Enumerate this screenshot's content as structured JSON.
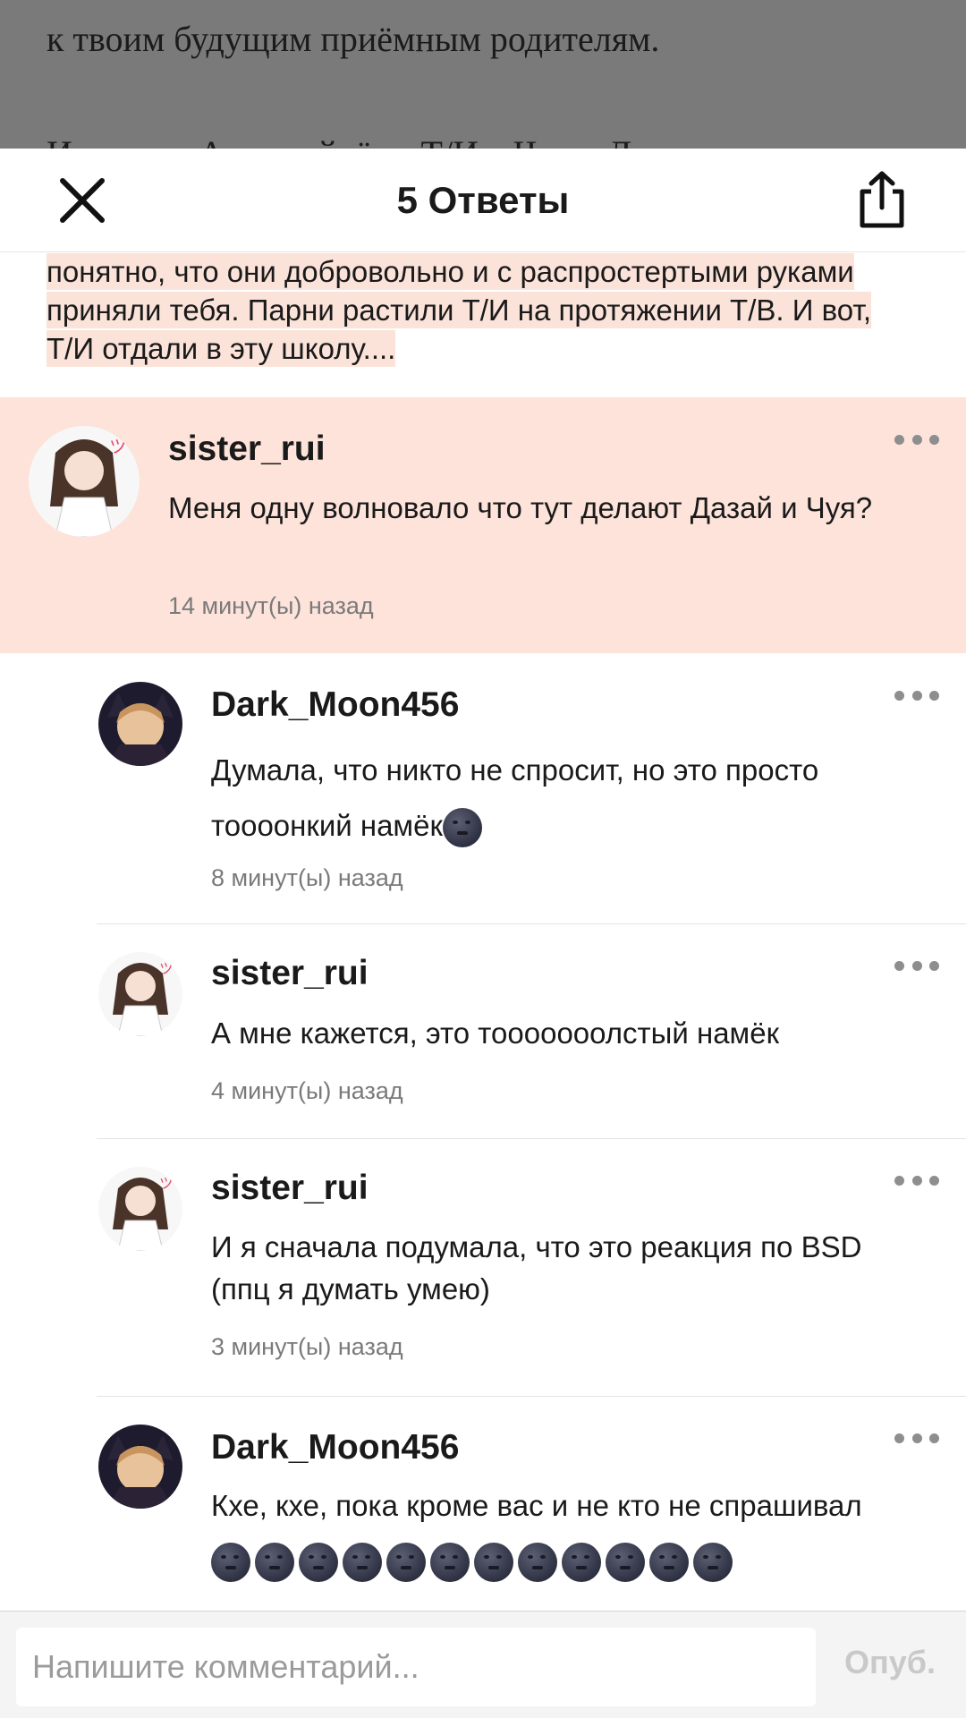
{
  "story": {
    "line1": "к твоим будущим приёмным родителям.",
    "line2": "И отсюда Автор уйдёт с Т/И к Чуе и Дазаю со"
  },
  "header": {
    "title": "5 Ответы",
    "close_icon": "close-icon",
    "share_icon": "share-icon"
  },
  "quote": {
    "line1": "понятно, что они добровольно и с распростертыми руками",
    "line2": "приняли тебя. Парни растили Т/И на протяжении Т/В. И вот,",
    "line3": "Т/И отдали в эту школу...."
  },
  "comments": [
    {
      "username": "sister_rui",
      "text": "Меня одну волновало что тут делают Дазай и Чуя?",
      "time": "14 минут(ы) назад"
    },
    {
      "username": "Dark_Moon456",
      "text": "Думала, что никто не спросит, но это просто тоооонкий намёк",
      "emoji": "🌚",
      "time": "8 минут(ы) назад"
    },
    {
      "username": "sister_rui",
      "text": "А мне кажется, это тооооооолстый намёк",
      "time": "4 минут(ы) назад"
    },
    {
      "username": "sister_rui",
      "text": "И я сначала подумала, что это реакция по BSD (ппц я думать умею)",
      "time": "3 минут(ы) назад"
    },
    {
      "username": "Dark_Moon456",
      "text": "Кхе, кхе, пока кроме вас и не кто не спрашивал",
      "emoji_count": 12,
      "time": ""
    }
  ],
  "footer": {
    "placeholder": "Напишите комментарий...",
    "publish_label": "Опуб."
  }
}
